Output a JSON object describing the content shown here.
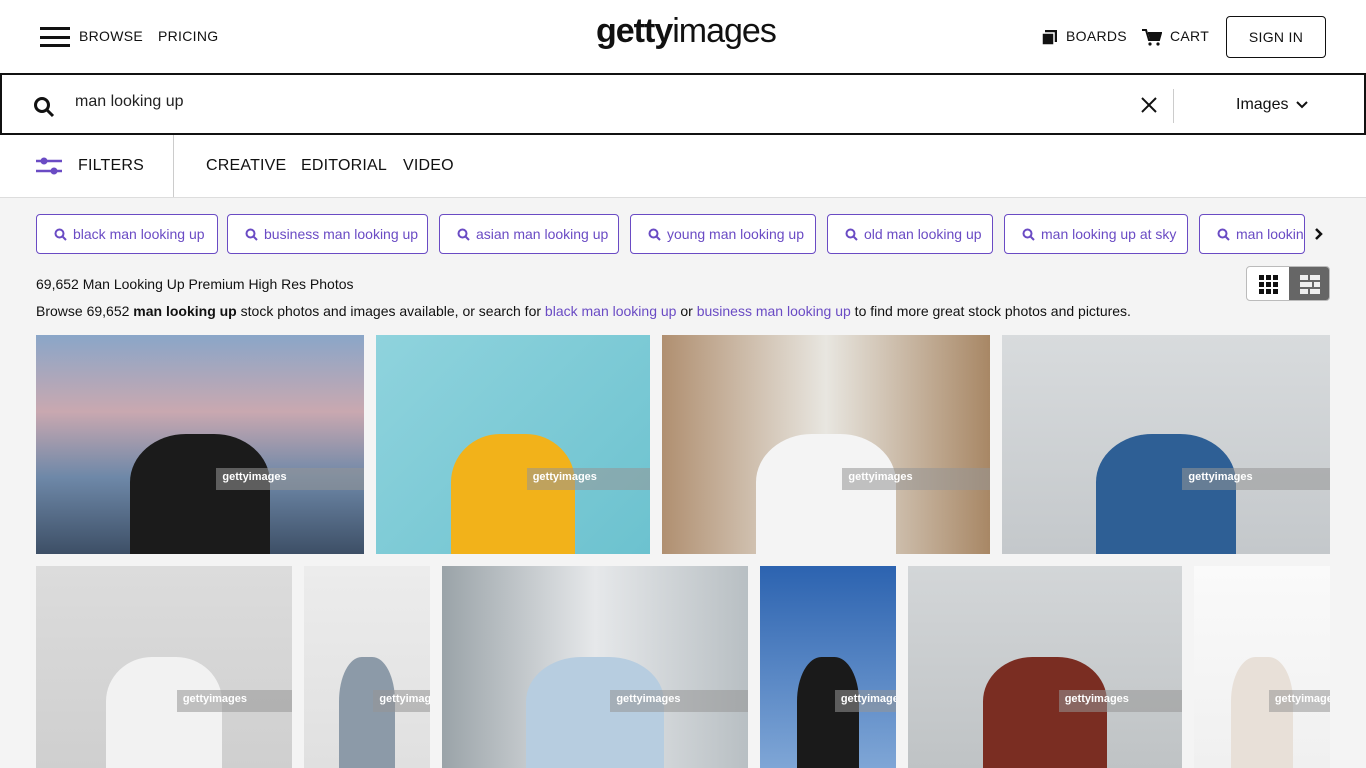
{
  "header": {
    "browse": "BROWSE",
    "pricing": "PRICING",
    "logo_bold": "getty",
    "logo_light": "images",
    "boards": "BOARDS",
    "cart": "CART",
    "sign_in": "SIGN IN"
  },
  "search": {
    "value": "man looking up",
    "type": "Images"
  },
  "filters": {
    "label": "FILTERS",
    "tabs": [
      "CREATIVE",
      "EDITORIAL",
      "VIDEO"
    ],
    "accent": "#6a4bc4"
  },
  "chips": [
    "black man looking up",
    "business man looking up",
    "asian man looking up",
    "young man looking up",
    "old man looking up",
    "man looking up at sky",
    "man looking up"
  ],
  "results": {
    "title": "69,652 Man Looking Up Premium High Res Photos",
    "desc_pre": "Browse 69,652 ",
    "desc_bold": "man looking up",
    "desc_mid": " stock photos and images available, or search for ",
    "link1": "black man looking up",
    "desc_or": " or ",
    "link2": "business man looking up",
    "desc_post": " to find more great stock photos and pictures."
  },
  "watermark": "gettyimages"
}
